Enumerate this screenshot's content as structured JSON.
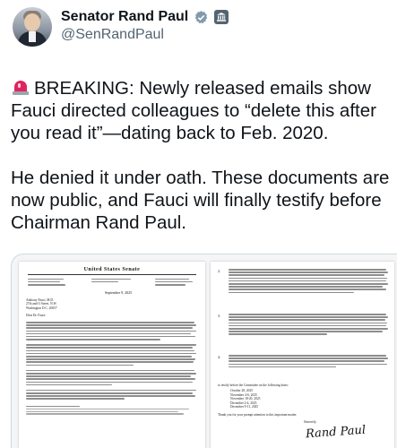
{
  "author": {
    "display_name": "Senator Rand Paul",
    "handle": "@SenRandPaul",
    "avatar_icon": "profile-photo",
    "verified_icon": "verified-badge-icon",
    "affiliation_icon": "government-building-icon",
    "accent_color": "#1d9bf0"
  },
  "tweet": {
    "emoji_icon": "police-siren-icon",
    "paragraph_1": "BREAKING: Newly released emails show Fauci directed colleagues to “delete this after you read it”—dating back to Feb. 2020.",
    "paragraph_2": "He denied it under oath. These documents are now public, and Fauci will finally testify before Chairman Rand Paul."
  },
  "document": {
    "letterhead": "United States Senate",
    "date": "September 9, 2025",
    "salutation": "Dear Dr. Fauci:",
    "address": [
      "Anthony Fauci, M.D.",
      "27th and O Street, N.W.",
      "Washington D.C. 20057"
    ],
    "list_numbers": [
      "2.",
      "3.",
      "4."
    ],
    "dates_intro": "to testify before the Committee on the following dates:",
    "dates": [
      "October 28, 2025",
      "November 4-6, 2025",
      "November 18-20, 2025",
      "December 2-4, 2025",
      "December 9-11, 2025"
    ],
    "closing_thanks": "Thank you for your prompt attention to this important matter.",
    "closing": "Sincerely,",
    "signature": "Rand Paul"
  }
}
